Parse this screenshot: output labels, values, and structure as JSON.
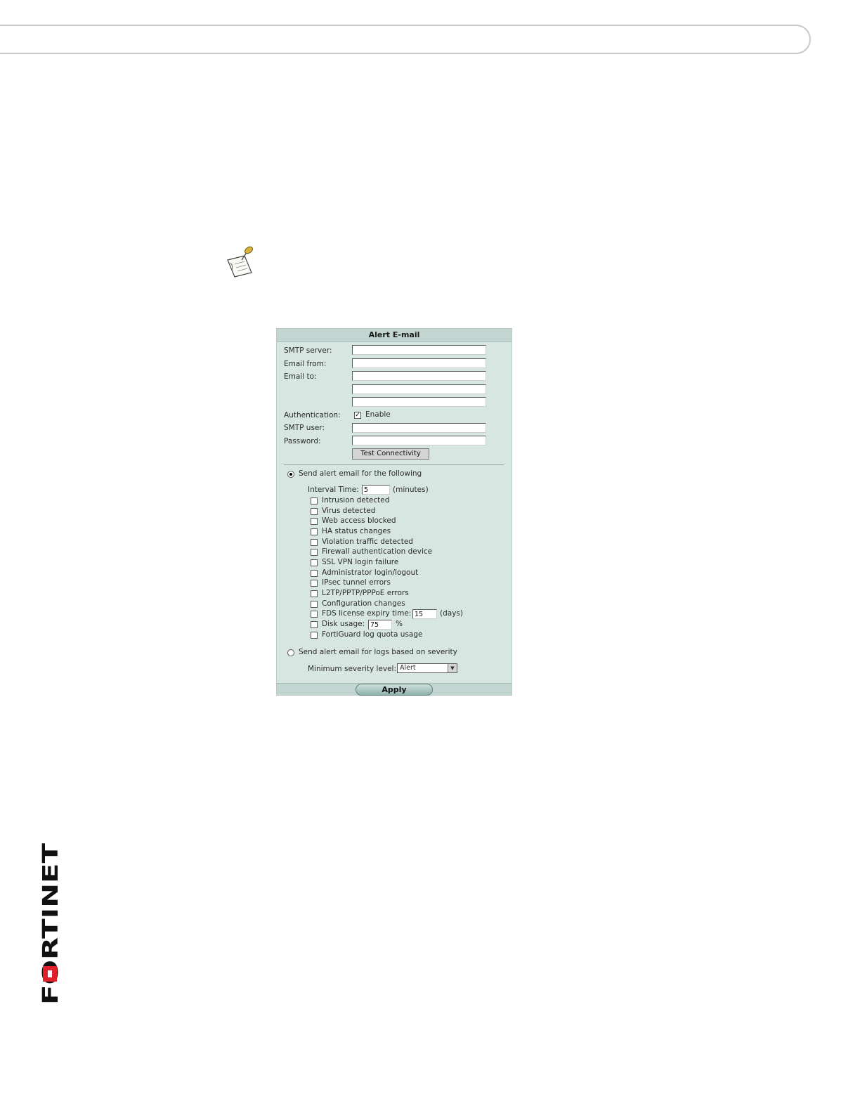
{
  "form": {
    "title": "Alert E-mail",
    "smtp_server_label": "SMTP server:",
    "email_from_label": "Email from:",
    "email_to_label": "Email to:",
    "authentication_label": "Authentication:",
    "enable_label": "Enable",
    "smtp_user_label": "SMTP user:",
    "password_label": "Password:",
    "test_button": "Test Connectivity",
    "send_following_label": "Send alert email for the following",
    "interval_label": "Interval Time:",
    "interval_value": "5",
    "interval_unit": "(minutes)",
    "events": [
      "Intrusion detected",
      "Virus detected",
      "Web access blocked",
      "HA status changes",
      "Violation traffic detected",
      "Firewall authentication device",
      "SSL VPN login failure",
      "Administrator login/logout",
      "IPsec tunnel errors",
      "L2TP/PPTP/PPPoE errors",
      "Configuration changes",
      "FDS license expiry time:",
      "Disk usage:",
      "FortiGuard log quota usage"
    ],
    "fds_value": "15",
    "fds_unit": "(days)",
    "disk_value": "75",
    "disk_unit": "%",
    "send_severity_label": "Send alert email for logs based on severity",
    "min_severity_label": "Minimum severity level:",
    "min_severity_value": "Alert",
    "apply_button": "Apply"
  },
  "logo_text": "FORTINET"
}
